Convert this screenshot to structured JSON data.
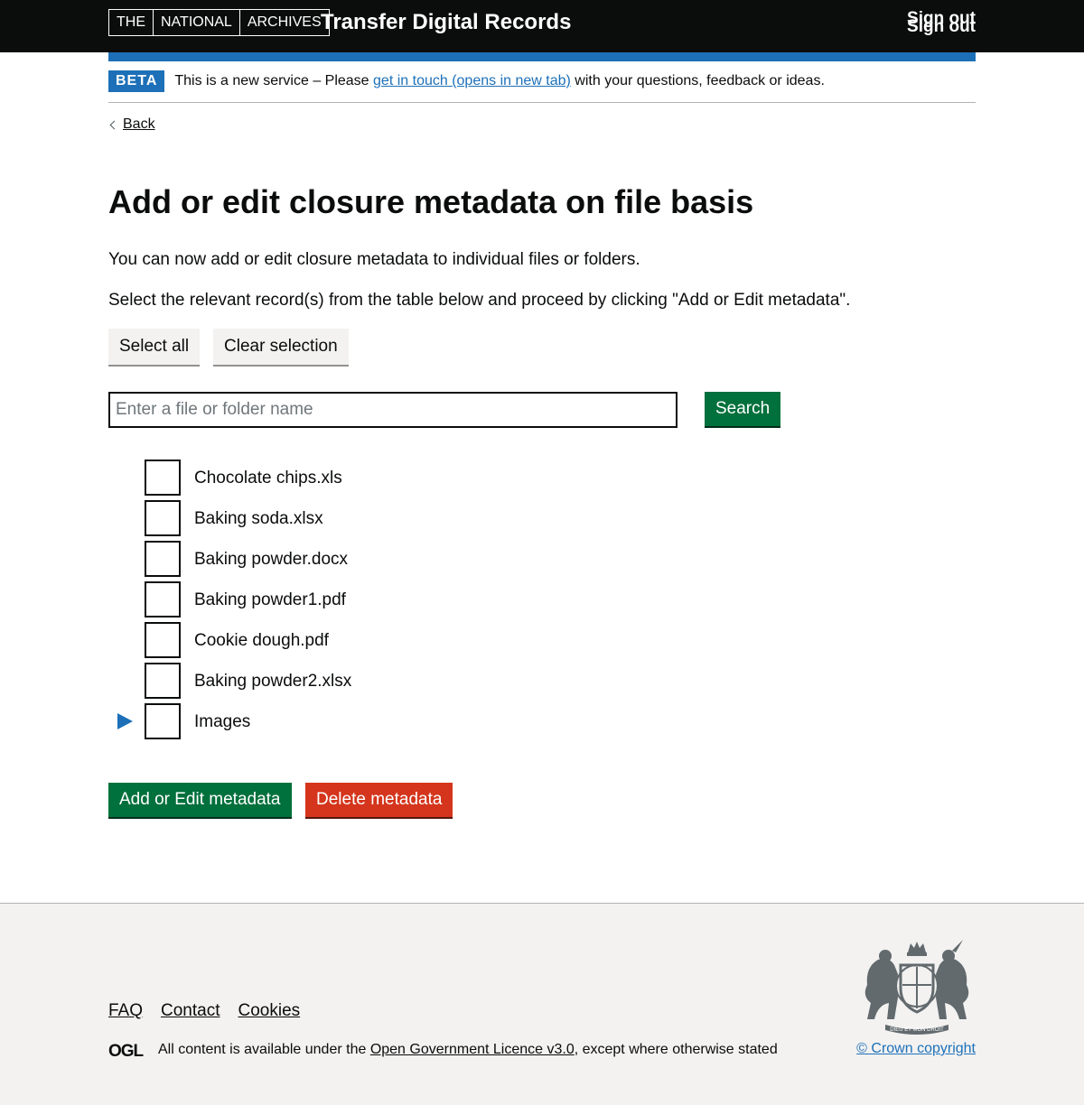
{
  "header": {
    "logo_parts": [
      "THE",
      "NATIONAL",
      "ARCHIVES"
    ],
    "service_name": "Transfer Digital Records",
    "sign_out": "Sign out"
  },
  "phase_banner": {
    "tag": "BETA",
    "text_before": "This is a new service – Please ",
    "link": "get in touch (opens in new tab)",
    "text_after": " with your questions, feedback or ideas."
  },
  "back_link": "Back",
  "page": {
    "title": "Add or edit closure metadata on file basis",
    "intro": "You can now add or edit closure metadata to individual files or folders.",
    "instruction": "Select the relevant record(s) from the table below and proceed by clicking \"Add or Edit metadata\"."
  },
  "selection_buttons": {
    "select_all": "Select all",
    "clear_selection": "Clear selection"
  },
  "search": {
    "placeholder": "Enter a file or folder name",
    "value": "",
    "button": "Search"
  },
  "tree": {
    "items": [
      {
        "label": "Chocolate chips.xls",
        "checked": false,
        "type": "file"
      },
      {
        "label": "Baking soda.xlsx",
        "checked": false,
        "type": "file"
      },
      {
        "label": "Baking powder.docx",
        "checked": false,
        "type": "file"
      },
      {
        "label": "Baking powder1.pdf",
        "checked": false,
        "type": "file"
      },
      {
        "label": "Cookie dough.pdf",
        "checked": false,
        "type": "file"
      },
      {
        "label": "Baking powder2.xlsx",
        "checked": false,
        "type": "file"
      },
      {
        "label": "Images",
        "checked": false,
        "type": "folder",
        "expanded": false
      }
    ]
  },
  "actions": {
    "add_edit": "Add or Edit metadata",
    "delete": "Delete metadata"
  },
  "footer": {
    "links": [
      "FAQ",
      "Contact",
      "Cookies"
    ],
    "licence_before": "All content is available under the ",
    "licence_link": "Open Government Licence v3.0",
    "licence_after": ", except where otherwise stated",
    "copyright": "© Crown copyright",
    "crest_motto": "DIEU ET MON DROIT",
    "ogl_logo": "OGL"
  },
  "colors": {
    "header_bg": "#0b0c0c",
    "brand_blue": "#1d70b8",
    "primary_green": "#00703c",
    "danger_red": "#d4351c",
    "footer_bg": "#f3f2f1"
  }
}
